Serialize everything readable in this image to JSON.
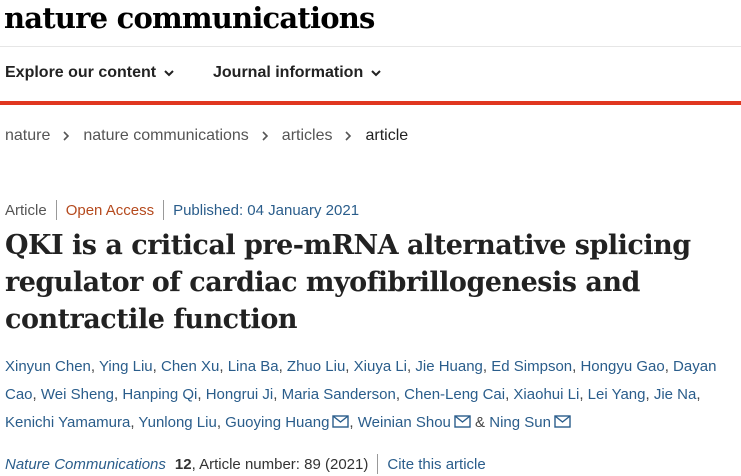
{
  "brand": {
    "logo_text": "nature communications",
    "accent_color": "#e0361f"
  },
  "nav": {
    "explore_label": "Explore our content",
    "journal_label": "Journal information"
  },
  "breadcrumb": [
    "nature",
    "nature communications",
    "articles",
    "article"
  ],
  "article": {
    "type": "Article",
    "access": "Open Access",
    "published": "Published: 04 January 2021",
    "title": "QKI is a critical pre-mRNA alternative splicing regulator of cardiac myofibrillogenesis and contractile function",
    "authors": [
      {
        "name": "Xinyun Chen",
        "corresponding": false
      },
      {
        "name": "Ying Liu",
        "corresponding": false
      },
      {
        "name": "Chen Xu",
        "corresponding": false
      },
      {
        "name": "Lina Ba",
        "corresponding": false
      },
      {
        "name": "Zhuo Liu",
        "corresponding": false
      },
      {
        "name": "Xiuya Li",
        "corresponding": false
      },
      {
        "name": "Jie Huang",
        "corresponding": false
      },
      {
        "name": "Ed Simpson",
        "corresponding": false
      },
      {
        "name": "Hongyu Gao",
        "corresponding": false
      },
      {
        "name": "Dayan Cao",
        "corresponding": false
      },
      {
        "name": "Wei Sheng",
        "corresponding": false
      },
      {
        "name": "Hanping Qi",
        "corresponding": false
      },
      {
        "name": "Hongrui Ji",
        "corresponding": false
      },
      {
        "name": "Maria Sanderson",
        "corresponding": false
      },
      {
        "name": "Chen-Leng Cai",
        "corresponding": false
      },
      {
        "name": "Xiaohui Li",
        "corresponding": false
      },
      {
        "name": "Lei Yang",
        "corresponding": false
      },
      {
        "name": "Jie Na",
        "corresponding": false
      },
      {
        "name": "Kenichi Yamamura",
        "corresponding": false
      },
      {
        "name": "Yunlong Liu",
        "corresponding": false
      },
      {
        "name": "Guoying Huang",
        "corresponding": true
      },
      {
        "name": "Weinian Shou",
        "corresponding": true
      },
      {
        "name": "Ning Sun",
        "corresponding": true
      }
    ],
    "journal": "Nature Communications",
    "volume": "12",
    "article_number": ", Article number: 89 (2021)",
    "cite_label": "Cite this article"
  },
  "icons": {
    "nav_chevron": "chevron-down-icon",
    "crumb_sep": "chevron-right-icon",
    "email": "envelope-icon"
  }
}
